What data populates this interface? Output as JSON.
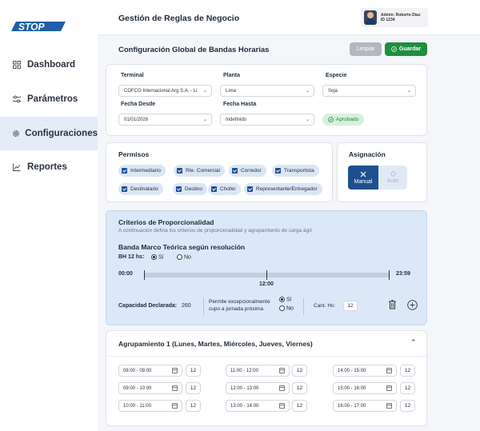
{
  "brand": {
    "logo": "STOP"
  },
  "sidebar": {
    "items": [
      {
        "label": "Dashboard",
        "icon": "grid-icon"
      },
      {
        "label": "Parámetros",
        "icon": "sliders-icon"
      },
      {
        "label": "Configuraciones",
        "icon": "gear-icon",
        "active": true
      },
      {
        "label": "Reportes",
        "icon": "chart-line-icon"
      }
    ]
  },
  "header": {
    "title": "Gestión de Reglas de Negocio",
    "user_name": "Admin: Roberto Díaz",
    "user_id": "ID 1234"
  },
  "page": {
    "title": "Configuración Global de Bandas Horarias",
    "clear_label": "Limpiar",
    "save_label": "Guardar"
  },
  "filters": {
    "terminal_label": "Terminal",
    "terminal_value": "COFCO Internacional Arg S.A. - Li",
    "planta_label": "Planta",
    "planta_value": "Lima",
    "especie_label": "Especie",
    "especie_value": "Soja",
    "fecha_desde_label": "Fecha Desde",
    "fecha_desde_value": "01/01/2026",
    "fecha_hasta_label": "Fecha Hasta",
    "fecha_hasta_value": "Indefinido",
    "status": "Aprobado"
  },
  "permisos": {
    "title": "Permisos",
    "items": [
      "Intermediario",
      "Rte. Comercial",
      "Corredor",
      "Transportista",
      "Destinatario",
      "Destino",
      "Chofer",
      "Representante/Entregador"
    ]
  },
  "asignacion": {
    "title": "Asignación",
    "manual": "Manual",
    "auto": "Auto"
  },
  "proporcionalidad": {
    "title": "Criterios de Proporcionalidad",
    "subtitle": "A continuación defina los criterios de proporcionalidad y agrupamiento de carga ágil:",
    "banda_title": "Banda Marco Teórica según resolución",
    "bh_label": "BH 12 hs:",
    "yes": "Sí",
    "no": "No",
    "start_time": "00:00",
    "mid_time": "12:00",
    "end_time": "23:59",
    "capacity_label": "Capacidad Declarada:",
    "capacity_value": "260",
    "exception_line1": "Permite excepcionalmente",
    "exception_line2": "cupo a jornada próxima",
    "exc_yes": "Sí",
    "exc_no": "No",
    "cant_label": "Cant. Hs:",
    "cant_value": "12"
  },
  "agrupamiento": {
    "title": "Agrupamiento 1 (Lunes, Martes, Miércoles, Jueves, Viernes)",
    "columns": [
      [
        {
          "range": "08:00 - 09:00",
          "count": "12"
        },
        {
          "range": "09:00 - 10:00",
          "count": "12"
        },
        {
          "range": "10:00 - 11:00",
          "count": "12"
        }
      ],
      [
        {
          "range": "11:00 - 12:00",
          "count": "12"
        },
        {
          "range": "12:00 - 13:00",
          "count": "12"
        },
        {
          "range": "13:00 - 14:00",
          "count": "12"
        }
      ],
      [
        {
          "range": "14:00 - 15:00",
          "count": "12"
        },
        {
          "range": "15:00 - 16:00",
          "count": "12"
        },
        {
          "range": "16:00 - 17:00",
          "count": "12"
        }
      ]
    ]
  }
}
